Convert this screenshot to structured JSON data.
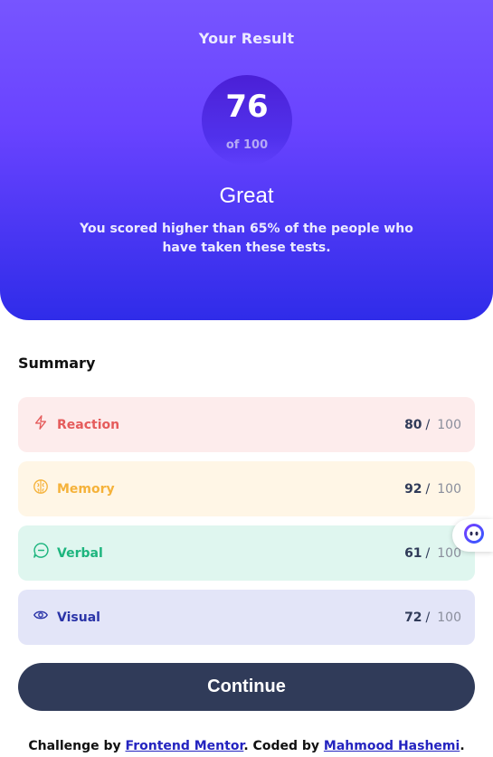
{
  "result": {
    "heading": "Your Result",
    "score": "76",
    "total": "of 100",
    "verdict": "Great",
    "description": "You scored higher than 65% of the people who have taken these tests."
  },
  "summary": {
    "title": "Summary",
    "categories": [
      {
        "label": "Reaction",
        "score": "80",
        "separator": "/",
        "max": "100",
        "color": "#e55b5b",
        "bg": "#fdecec",
        "icon": "lightning-icon"
      },
      {
        "label": "Memory",
        "score": "92",
        "separator": "/",
        "max": "100",
        "color": "#f5b23a",
        "bg": "#fff6e6",
        "icon": "brain-icon"
      },
      {
        "label": "Verbal",
        "score": "61",
        "separator": "/",
        "max": "100",
        "color": "#1db57e",
        "bg": "#dff6ef",
        "icon": "chat-icon"
      },
      {
        "label": "Visual",
        "score": "72",
        "separator": "/",
        "max": "100",
        "color": "#2a34a8",
        "bg": "#e3e5f8",
        "icon": "eye-icon"
      }
    ]
  },
  "actions": {
    "continue_label": "Continue"
  },
  "attribution": {
    "prefix": "Challenge by ",
    "link1": "Frontend Mentor",
    "middle": ". Coded by ",
    "link2": "Mahmood Hashemi",
    "suffix": "."
  },
  "colors": {
    "gradient_top": "#7755ff",
    "gradient_bottom": "#2f2ce9",
    "button": "#303b59"
  }
}
